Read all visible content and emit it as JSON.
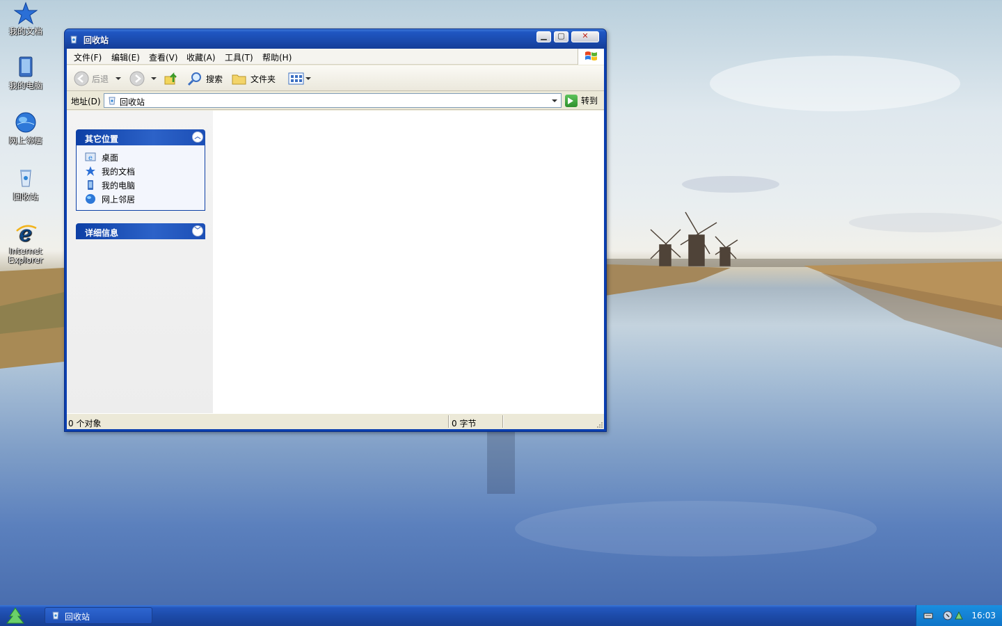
{
  "desktop": {
    "icons": [
      {
        "label": "我的文档",
        "icon": "star-documents-icon"
      },
      {
        "label": "我的电脑",
        "icon": "computer-icon"
      },
      {
        "label": "网上邻居",
        "icon": "network-globe-icon"
      },
      {
        "label": "回收站",
        "icon": "recycle-bin-icon"
      },
      {
        "label": "Internet Explorer",
        "icon": "internet-explorer-icon"
      }
    ]
  },
  "window": {
    "title": "回收站",
    "menu": [
      "文件(F)",
      "编辑(E)",
      "查看(V)",
      "收藏(A)",
      "工具(T)",
      "帮助(H)"
    ],
    "toolbar": {
      "back_label": "后退",
      "search_label": "搜索",
      "folders_label": "文件夹"
    },
    "address": {
      "label": "地址(D)",
      "value": "回收站",
      "go_label": "转到"
    },
    "taskpane": {
      "other_places": {
        "title": "其它位置",
        "links": [
          "桌面",
          "我的文档",
          "我的电脑",
          "网上邻居"
        ]
      },
      "details": {
        "title": "详细信息"
      }
    },
    "status": {
      "objects": "0 个对象",
      "size": "0 字节"
    }
  },
  "taskbar": {
    "task_label": "回收站",
    "clock": "16:03"
  },
  "colors": {
    "title_blue": "#1a4aad",
    "pane_header": "#0d3fa5",
    "taskbar_blue": "#1d4ba9",
    "tray_blue": "#1080d4"
  }
}
